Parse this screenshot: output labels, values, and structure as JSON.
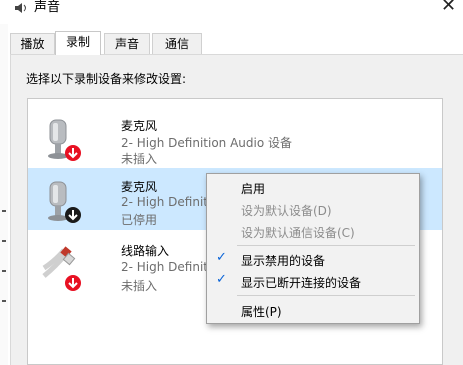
{
  "window": {
    "title": "声音",
    "close_glyph": "✕"
  },
  "tabs": [
    {
      "label": "播放"
    },
    {
      "label": "录制",
      "active": true
    },
    {
      "label": "声音"
    },
    {
      "label": "通信"
    }
  ],
  "instruction": "选择以下录制设备来修改设置:",
  "devices": [
    {
      "name": "麦克风",
      "line2": "2- High Definition Audio 设备",
      "status": "未插入",
      "icon": "microphone-icon",
      "badge": "red-down-arrow-badge"
    },
    {
      "name": "麦克风",
      "line2": "2- High Definition A",
      "status": "已停用",
      "icon": "microphone-icon",
      "badge": "black-down-arrow-badge"
    },
    {
      "name": "线路输入",
      "line2": "2- High Definition A",
      "status": "未插入",
      "icon": "line-in-cable-icon",
      "badge": "red-down-arrow-badge"
    }
  ],
  "context_menu": {
    "items": [
      {
        "label": "启用",
        "enabled": true
      },
      {
        "label": "设为默认设备(D)",
        "enabled": false
      },
      {
        "label": "设为默认通信设备(C)",
        "enabled": false
      },
      {
        "label": "显示禁用的设备",
        "enabled": true,
        "checked": true
      },
      {
        "label": "显示已断开连接的设备",
        "enabled": true,
        "checked": true
      },
      {
        "label": "属性(P)",
        "enabled": true
      }
    ],
    "check_glyph": "✓"
  },
  "colors": {
    "selection": "#cce8ff",
    "disabled_text": "#8c8c8c",
    "check": "#0a64d8",
    "badge_red": "#e81123"
  }
}
